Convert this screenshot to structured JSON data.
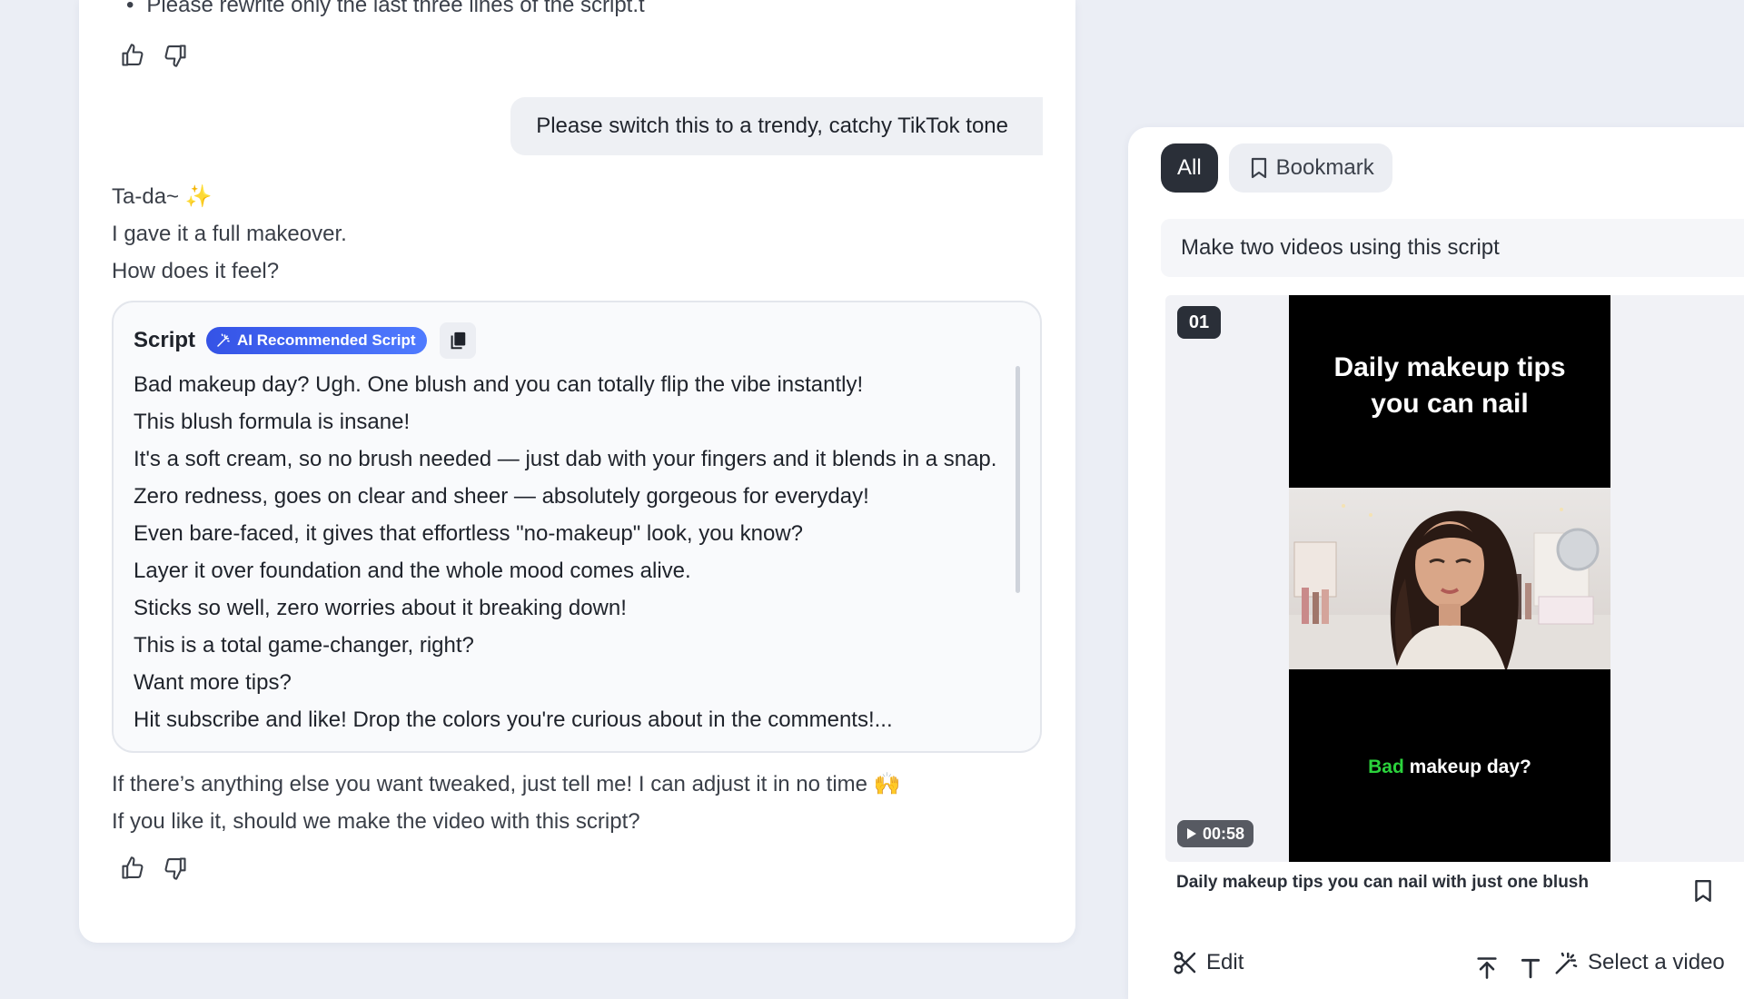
{
  "chat": {
    "previous_bullet": "Please rewrite only the last three lines of the script.t",
    "user_message": "Please switch this to a trendy, catchy TikTok tone",
    "ai_intro": [
      "Ta-da~",
      "I gave it a full makeover.",
      "How does it feel?"
    ],
    "ai_intro_emoji": "✨",
    "script": {
      "title": "Script",
      "badge": "AI Recommended Script",
      "lines": [
        "Bad makeup day? Ugh. One blush and you can totally flip the vibe instantly!",
        "This blush formula is insane!",
        "It's a soft cream, so no brush needed — just dab with your fingers and it blends in a snap.",
        "Zero redness, goes on clear and sheer — absolutely gorgeous for everyday!",
        "Even bare-faced, it gives that effortless \"no-makeup\" look, you know?",
        "Layer it over foundation and the whole mood comes alive.",
        "Sticks so well, zero worries about it breaking down!",
        "This is a total game-changer, right?",
        "Want more tips?",
        "Hit subscribe and like! Drop the colors you're curious about in the comments!..."
      ]
    },
    "ai_outro": [
      "If there’s anything else you want tweaked, just tell me! I can adjust it in no time",
      "If you like it, should we make the video with this script?"
    ],
    "ai_outro_emoji": "🙌"
  },
  "results": {
    "tabs": [
      "All",
      "Bookmark"
    ],
    "active_tab": "All",
    "prompt": "Make two videos using this script",
    "video": {
      "number": "01",
      "overlay_title": [
        "Daily makeup tips",
        "you can nail"
      ],
      "caption_highlight": "Bad",
      "caption_rest": "makeup day?",
      "duration": "00:58",
      "title": "Daily makeup tips you can nail with just one blush"
    },
    "actions": {
      "edit": "Edit",
      "select": "Select a video"
    }
  },
  "colors": {
    "background": "#ebeef5",
    "accent_blue": "#3553e6",
    "dark": "#2a2f38",
    "caption_green": "#2bd33c"
  }
}
